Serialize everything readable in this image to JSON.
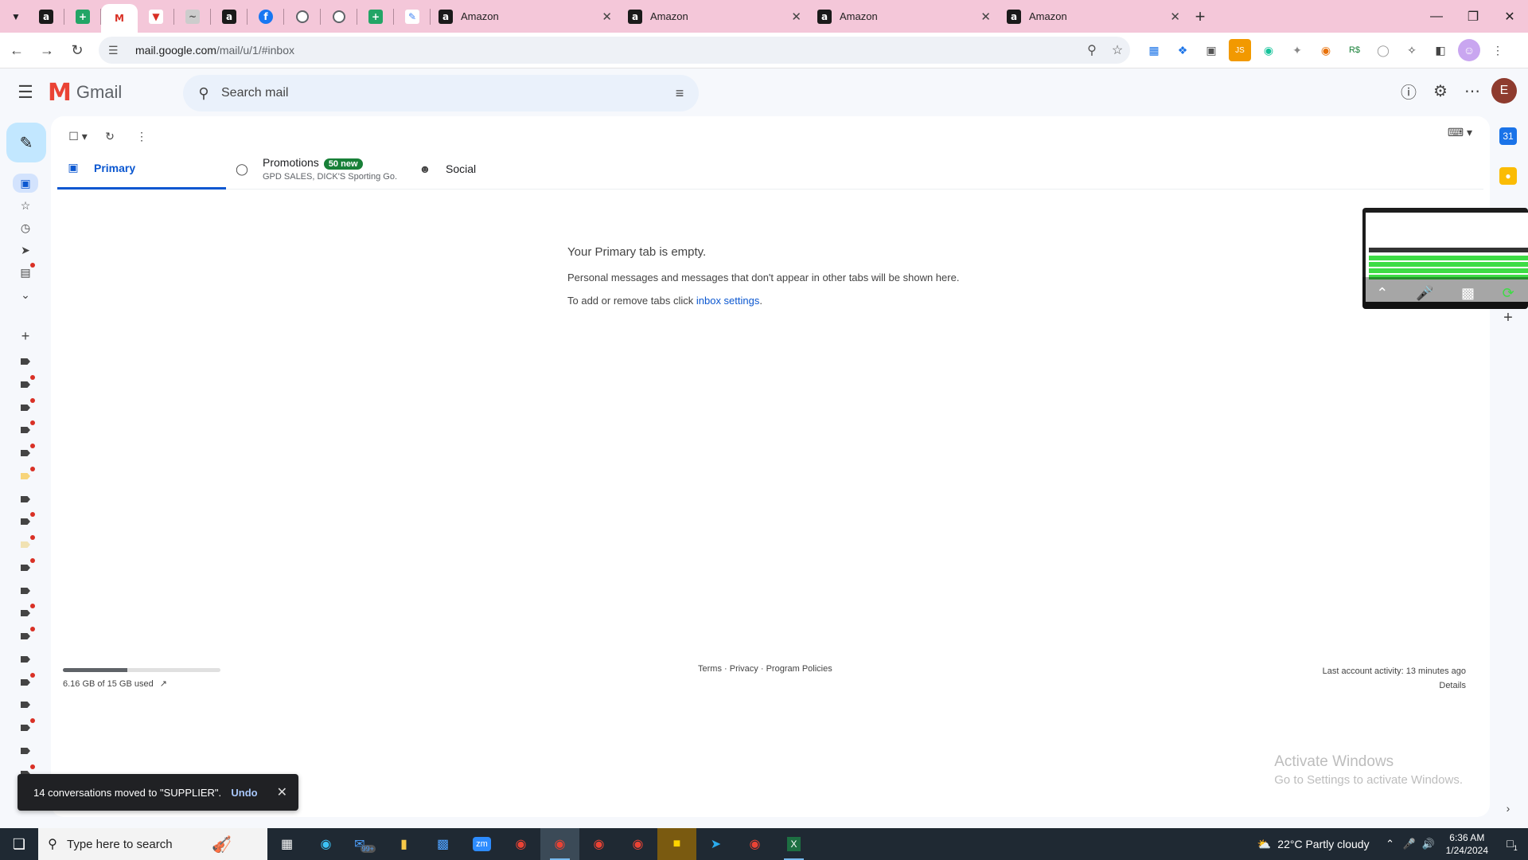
{
  "browser": {
    "tabs": [
      {
        "title": "Amazon"
      },
      {
        "title": "Amazon"
      },
      {
        "title": "Amazon"
      },
      {
        "title": "Amazon"
      }
    ],
    "url_host": "mail.google.com",
    "url_path": "/mail/u/1/#inbox"
  },
  "gmail": {
    "logo_text": "Gmail",
    "search_placeholder": "Search mail",
    "avatar_initial": "E",
    "category_tabs": {
      "primary": "Primary",
      "promotions": "Promotions",
      "promotions_badge": "50 new",
      "promotions_sub": "GPD SALES, DICK'S Sporting Go...",
      "social": "Social"
    },
    "empty_state": {
      "heading": "Your Primary tab is empty.",
      "line1": "Personal messages and messages that don't appear in other tabs will be shown here.",
      "line2_prefix": "To add or remove tabs click ",
      "line2_link": "inbox settings",
      "line2_suffix": "."
    },
    "storage": {
      "used_text": "6.16 GB of 15 GB used",
      "fraction": 0.41
    },
    "footer": {
      "terms": "Terms",
      "privacy": "Privacy",
      "policies": "Program Policies",
      "dot": " · ",
      "activity": "Last account activity: 13 minutes ago",
      "details": "Details"
    },
    "snackbar": {
      "message": "14 conversations moved to \"SUPPLIER\".",
      "undo": "Undo"
    }
  },
  "watermark": {
    "line1": "Activate Windows",
    "line2": "Go to Settings to activate Windows."
  },
  "taskbar": {
    "search_placeholder": "Type here to search",
    "weather": "22°C  Partly cloudy",
    "time": "6:36 AM",
    "date": "1/24/2024",
    "mail_badge": "99+",
    "notif_count": "1"
  },
  "colors": {
    "tabstrip": "#f4c7d9",
    "accent": "#0b57d0",
    "compose": "#c2e7ff",
    "badge": "#188038"
  }
}
